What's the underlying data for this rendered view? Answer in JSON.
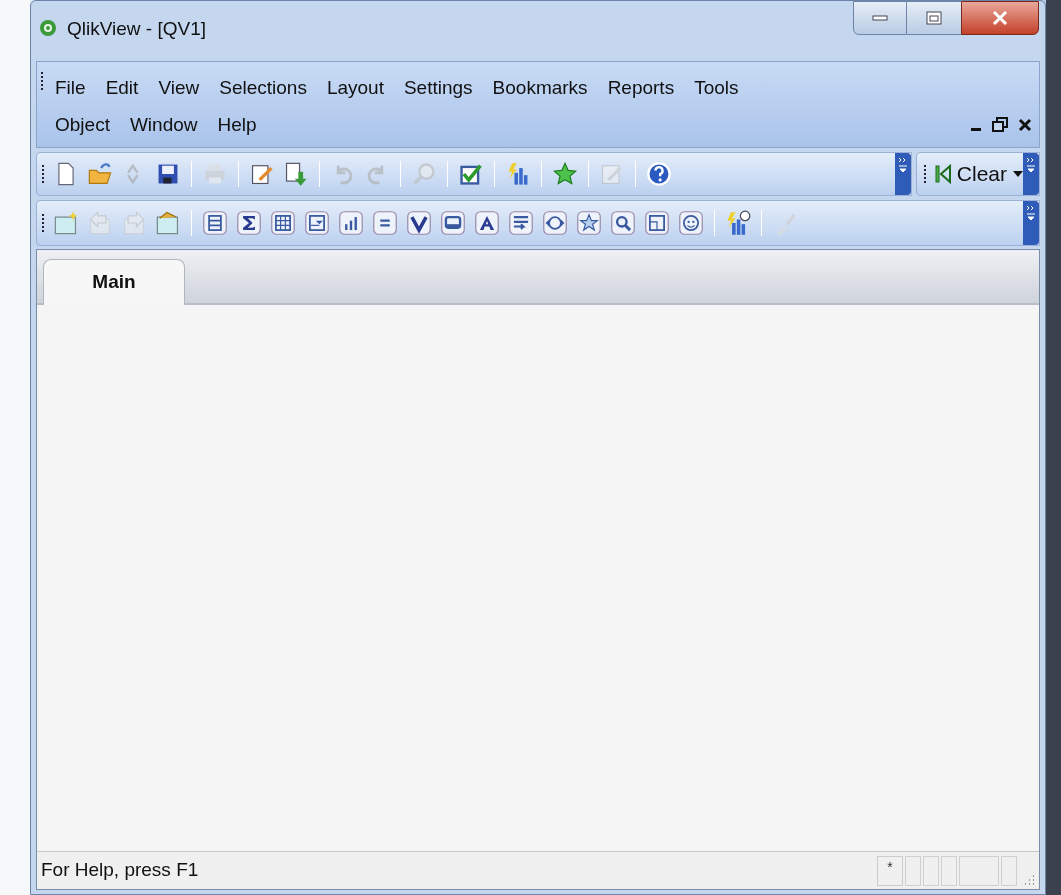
{
  "window": {
    "title": "QlikView - [QV1]"
  },
  "menu": [
    {
      "label": "File"
    },
    {
      "label": "Edit"
    },
    {
      "label": "View"
    },
    {
      "label": "Selections"
    },
    {
      "label": "Layout"
    },
    {
      "label": "Settings"
    },
    {
      "label": "Bookmarks"
    },
    {
      "label": "Reports"
    },
    {
      "label": "Tools"
    },
    {
      "label": "Object"
    },
    {
      "label": "Window"
    },
    {
      "label": "Help"
    }
  ],
  "toolbar_standard": [
    {
      "kind": "button",
      "disabled": false
    },
    {
      "kind": "button",
      "disabled": false
    },
    {
      "kind": "button",
      "disabled": true
    },
    {
      "kind": "button",
      "disabled": false
    },
    {
      "kind": "separator"
    },
    {
      "kind": "button",
      "disabled": true
    },
    {
      "kind": "separator"
    },
    {
      "kind": "button",
      "disabled": false
    },
    {
      "kind": "button",
      "disabled": false
    },
    {
      "kind": "separator"
    },
    {
      "kind": "button",
      "disabled": true
    },
    {
      "kind": "button",
      "disabled": true
    },
    {
      "kind": "separator"
    },
    {
      "kind": "button",
      "disabled": true
    },
    {
      "kind": "separator"
    },
    {
      "kind": "button",
      "disabled": false
    },
    {
      "kind": "separator"
    },
    {
      "kind": "button",
      "disabled": false
    },
    {
      "kind": "separator"
    },
    {
      "kind": "button",
      "disabled": false
    },
    {
      "kind": "separator"
    },
    {
      "kind": "button",
      "disabled": true
    },
    {
      "kind": "separator"
    },
    {
      "kind": "button",
      "disabled": false
    }
  ],
  "clear_button": {
    "label": "Clear"
  },
  "toolbar_design": [
    {
      "kind": "button",
      "disabled": false
    },
    {
      "kind": "button",
      "disabled": true
    },
    {
      "kind": "button",
      "disabled": true
    },
    {
      "kind": "button",
      "disabled": false
    },
    {
      "kind": "separator"
    },
    {
      "kind": "button",
      "disabled": false
    },
    {
      "kind": "button",
      "disabled": false
    },
    {
      "kind": "button",
      "disabled": false
    },
    {
      "kind": "button",
      "disabled": false
    },
    {
      "kind": "button",
      "disabled": false
    },
    {
      "kind": "button",
      "disabled": false
    },
    {
      "kind": "button",
      "disabled": false
    },
    {
      "kind": "button",
      "disabled": false
    },
    {
      "kind": "button",
      "disabled": false
    },
    {
      "kind": "button",
      "disabled": false
    },
    {
      "kind": "button",
      "disabled": false
    },
    {
      "kind": "button",
      "disabled": false
    },
    {
      "kind": "button",
      "disabled": false
    },
    {
      "kind": "button",
      "disabled": false
    },
    {
      "kind": "button",
      "disabled": false
    },
    {
      "kind": "separator"
    },
    {
      "kind": "button",
      "disabled": false
    },
    {
      "kind": "separator"
    },
    {
      "kind": "button",
      "disabled": true
    }
  ],
  "tabs": [
    {
      "label": "Main",
      "selected": true
    }
  ],
  "status_bar": {
    "text": "For Help, press F1",
    "indicator": "*"
  }
}
